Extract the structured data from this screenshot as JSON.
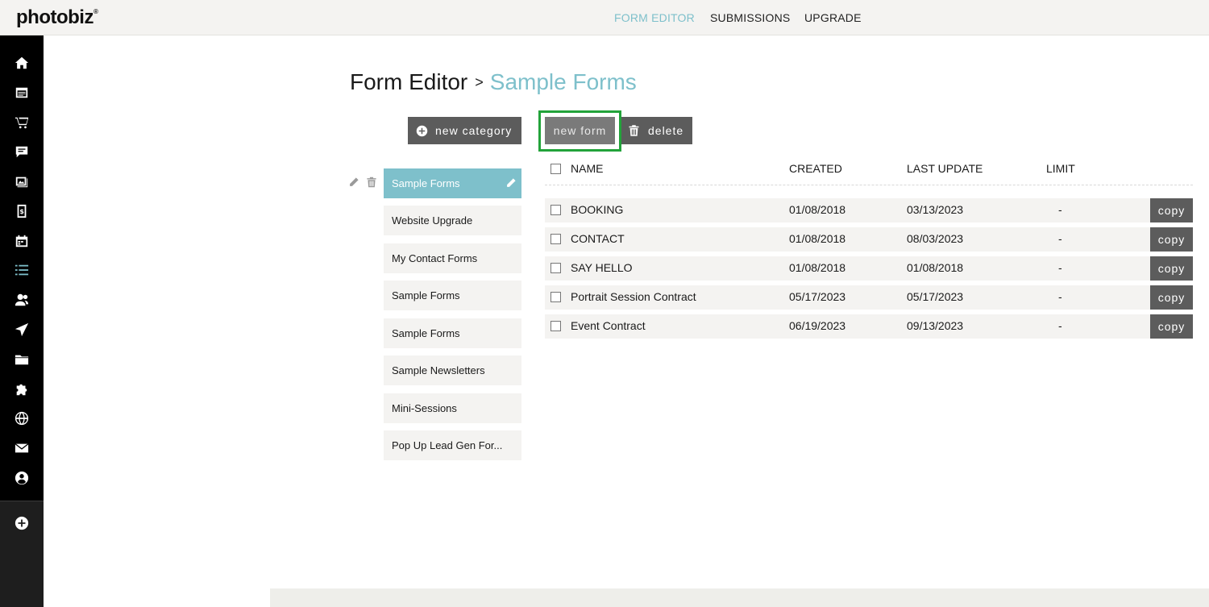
{
  "app": {
    "logo_text": "photobiz"
  },
  "topnav": [
    {
      "label": "FORM EDITOR",
      "active": true
    },
    {
      "label": "SUBMISSIONS",
      "active": false
    },
    {
      "label": "UPGRADE",
      "active": false
    }
  ],
  "sidebar": {
    "icons": [
      "home-icon",
      "website-icon",
      "store-cart-icon",
      "blog-chat-icon",
      "gallery-icon",
      "invoice-icon",
      "calendar-icon",
      "forms-list-icon",
      "contacts-icon",
      "send-icon",
      "folder-icon",
      "plugin-icon",
      "domain-globe-icon",
      "email-icon",
      "account-icon"
    ],
    "add_icon": "add-circle-icon"
  },
  "breadcrumb": {
    "root": "Form Editor",
    "separator": ">",
    "current": "Sample Forms"
  },
  "buttons": {
    "new_category": "new category",
    "new_form": "new form",
    "delete": "delete"
  },
  "categories": [
    {
      "label": "Sample Forms",
      "active": true
    },
    {
      "label": "Website Upgrade",
      "active": false
    },
    {
      "label": "My Contact Forms",
      "active": false
    },
    {
      "label": "Sample Forms",
      "active": false
    },
    {
      "label": "Sample Forms",
      "active": false
    },
    {
      "label": "Sample Newsletters",
      "active": false
    },
    {
      "label": "Mini-Sessions",
      "active": false
    },
    {
      "label": "Pop Up Lead Gen For...",
      "active": false
    }
  ],
  "table": {
    "columns": {
      "name": "NAME",
      "created": "CREATED",
      "last_update": "LAST UPDATE",
      "limit": "LIMIT"
    },
    "copy_label": "copy",
    "rows": [
      {
        "name": "BOOKING",
        "created": "01/08/2018",
        "last_update": "03/13/2023",
        "limit": "-"
      },
      {
        "name": "CONTACT",
        "created": "01/08/2018",
        "last_update": "08/03/2023",
        "limit": "-"
      },
      {
        "name": "SAY HELLO",
        "created": "01/08/2018",
        "last_update": "01/08/2018",
        "limit": "-"
      },
      {
        "name": "Portrait Session Contract",
        "created": "05/17/2023",
        "last_update": "05/17/2023",
        "limit": "-"
      },
      {
        "name": "Event Contract",
        "created": "06/19/2023",
        "last_update": "09/13/2023",
        "limit": "-"
      }
    ]
  },
  "colors": {
    "accent": "#7ec0cb",
    "button": "#5c5c5c",
    "highlight": "#22a33a",
    "sidebar": "#000000"
  }
}
